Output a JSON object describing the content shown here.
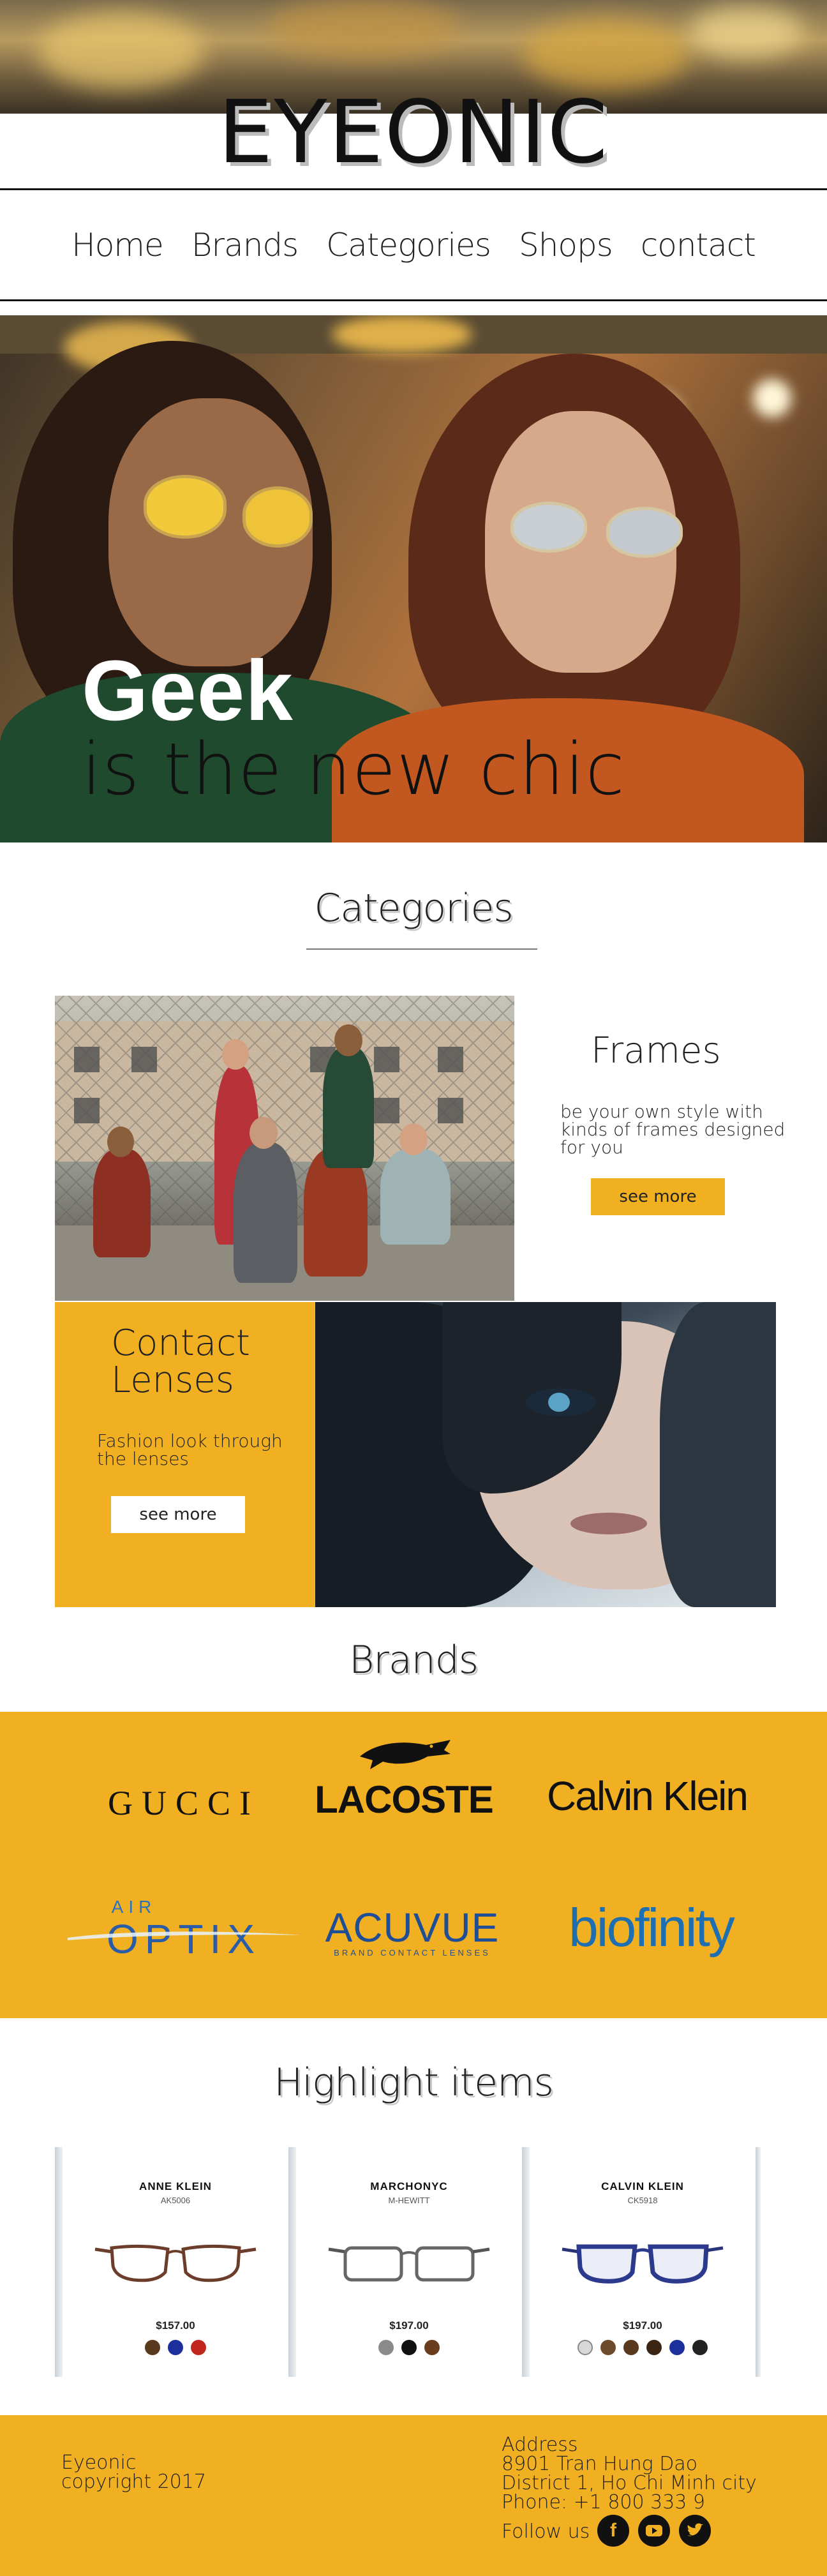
{
  "site": {
    "logo": "EYEONIC"
  },
  "nav": {
    "items": [
      "Home",
      "Brands",
      "Categories",
      "Shops",
      "contact"
    ]
  },
  "hero": {
    "title": "Geek",
    "subtitle": "is the new chic"
  },
  "categories": {
    "heading": "Categories",
    "frames": {
      "title": "Frames",
      "description": "be your own style with kinds of frames designed for you",
      "button": "see more"
    },
    "lenses": {
      "title_line1": "Contact",
      "title_line2": "Lenses",
      "description": "Fashion look through the lenses",
      "button": "see more"
    }
  },
  "brands": {
    "heading": "Brands",
    "logos": {
      "gucci": "GUCCI",
      "lacoste": "LACOSTE",
      "calvin_klein": "Calvin Klein",
      "air_optix_top": "AIR",
      "air_optix": "OPTIX",
      "acuvue": "ACUVUE",
      "acuvue_sub": "BRAND CONTACT LENSES",
      "biofinity": "biofinity"
    }
  },
  "highlights": {
    "heading": "Highlight items",
    "items": [
      {
        "brand": "ANNE KLEIN",
        "model": "AK5006",
        "price": "$157.00",
        "swatches": [
          "#5a3a1e",
          "#1d2f9c",
          "#c0261e"
        ]
      },
      {
        "brand": "MARCHONYC",
        "model": "M-HEWITT",
        "price": "$197.00",
        "swatches": [
          "#8a8a8a",
          "#111111",
          "#6b3d1f"
        ]
      },
      {
        "brand": "CALVIN KLEIN",
        "model": "CK5918",
        "price": "$197.00",
        "swatches": [
          "#d8d8d8",
          "#6b4b2b",
          "#5a3a1e",
          "#3a2414",
          "#1d2f9c",
          "#222222"
        ]
      }
    ]
  },
  "footer": {
    "company": "Eyeonic",
    "copyright": "copyright 2017",
    "address_label": "Address",
    "address_line1": "8901 Tran Hung Dao",
    "address_line2": "District 1, Ho Chi Minh city",
    "phone": "Phone: +1 800 333 9",
    "follow": "Follow us",
    "social": [
      "facebook",
      "youtube",
      "twitter"
    ]
  },
  "colors": {
    "accent": "#f1b022",
    "text": "#222222",
    "brand_blue": "#1d6fb2"
  }
}
